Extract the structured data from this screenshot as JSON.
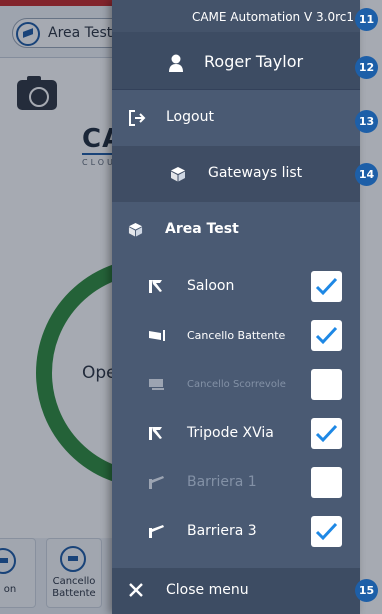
{
  "background": {
    "area_name": "Area Test",
    "brand": "CA",
    "brand_sub": "CLOU",
    "status": "Ope",
    "tiles": [
      {
        "label": "on"
      },
      {
        "label": "Cancello Battente"
      }
    ]
  },
  "drawer": {
    "version": "CAME Automation V 3.0rc1",
    "user_name": "Roger Taylor",
    "logout_label": "Logout",
    "gateways_label": "Gateways list",
    "area_label": "Area Test",
    "devices": [
      {
        "label": "Saloon",
        "checked": true,
        "enabled": true
      },
      {
        "label": "Cancello Battente",
        "checked": true,
        "enabled": true
      },
      {
        "label": "Cancello Scorrevole",
        "checked": false,
        "enabled": false
      },
      {
        "label": "Tripode XVia",
        "checked": true,
        "enabled": true
      },
      {
        "label": "Barriera 1",
        "checked": false,
        "enabled": false
      },
      {
        "label": "Barriera 3",
        "checked": true,
        "enabled": true
      }
    ],
    "close_label": "Close menu"
  },
  "markers": [
    "11",
    "12",
    "13",
    "14",
    "15"
  ],
  "colors": {
    "drawer_bg": "#4a5a73",
    "drawer_dark": "#3d4c63",
    "check_blue": "#1e88e5",
    "marker_blue": "#1d5fa8",
    "disabled_text": "#8391a6"
  }
}
